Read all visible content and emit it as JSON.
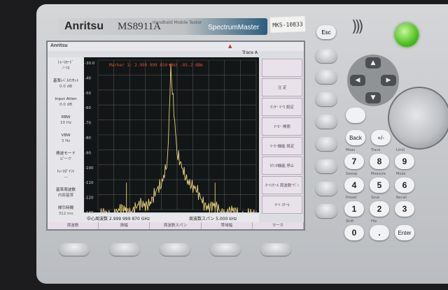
{
  "device": {
    "brand": "Anritsu",
    "model": "MS8911A",
    "tagline": "SpectrumMaster",
    "sub_tag": "Handheld Mobile Tester",
    "serial": "MKS-10833"
  },
  "screen": {
    "logo": "Anritsu",
    "trace": "Trace A",
    "marker_readout": "Marker 1: 2.999 999 850 GHz  -85.2 dBm",
    "left_params": [
      {
        "label": "ﾄﾚｰｽﾓｰﾄﾞ",
        "value": "ﾉｰﾏﾙ"
      },
      {
        "label": "基準ﾚﾍﾞﾙｵﾌｾｯﾄ",
        "value": "0.0 dB"
      },
      {
        "label": "Input Atten",
        "value": "0.0 dB"
      },
      {
        "label": "RBW",
        "value": "10 Hz"
      },
      {
        "label": "VBW",
        "value": "3 Hz"
      },
      {
        "label": "検波モード",
        "value": "ピーク"
      },
      {
        "label": "ﾄﾚｰｽﾎﾟｲﾝﾄ",
        "value": "—"
      },
      {
        "label": "基準周波数",
        "value": "内部基準"
      },
      {
        "label": "掃引時間",
        "value": "312 ms"
      }
    ],
    "y_ticks": [
      "-30.0",
      "-40",
      "-50",
      "-60",
      "-70",
      "-80",
      "-90",
      "-100",
      "-110",
      "-120",
      "-130"
    ],
    "status": {
      "center": "中心周波数 2.999 999 870 GHz",
      "span": "周波数スパン 5.000 kHz"
    },
    "right_menu": [
      "",
      "注\n定",
      "ｾﾝﾀｰ ﾏｰｶ\n設定",
      "ﾏｰｶｰ\n検索",
      "ﾏｰｶｰ機能\n設定",
      "ｶｳﾝﾀ機能\n停止",
      "ｵｰﾄｽｹｰﾙ\n周波数\"ﾊﾟﾝ",
      "ｵｰﾄ\nｽｹｰﾙ"
    ],
    "bottom_tabs": [
      "周波数",
      "振幅",
      "周波数スパン",
      "帯域幅",
      "マーカ"
    ]
  },
  "keypad": {
    "esc": "Esc",
    "back": "Back",
    "plus_minus": "+/-",
    "enter": "Enter",
    "digits": [
      "7",
      "8",
      "9",
      "4",
      "5",
      "6",
      "1",
      "2",
      "3",
      "0",
      "."
    ],
    "hints": [
      "Meas",
      "Trace",
      "Limit",
      "Sweep",
      "Measure",
      "Mode",
      "Preset",
      "Save",
      "Recall",
      "Shift",
      "File"
    ]
  },
  "chart_data": {
    "type": "line",
    "title": "",
    "xlabel": "",
    "ylabel": "",
    "ylim": [
      -130,
      -30
    ],
    "y_ticks": [
      -30,
      -40,
      -50,
      -60,
      -70,
      -80,
      -90,
      -100,
      -110,
      -120,
      -130
    ],
    "series": [
      {
        "x": [
          0,
          10,
          20,
          30,
          40,
          44,
          46,
          50,
          60,
          70,
          80,
          90,
          100
        ],
        "values": [
          -135,
          -132,
          -130,
          -127,
          -115,
          -95,
          -35,
          -95,
          -116,
          -128,
          -131,
          -133,
          -135
        ]
      }
    ],
    "grid": true
  }
}
